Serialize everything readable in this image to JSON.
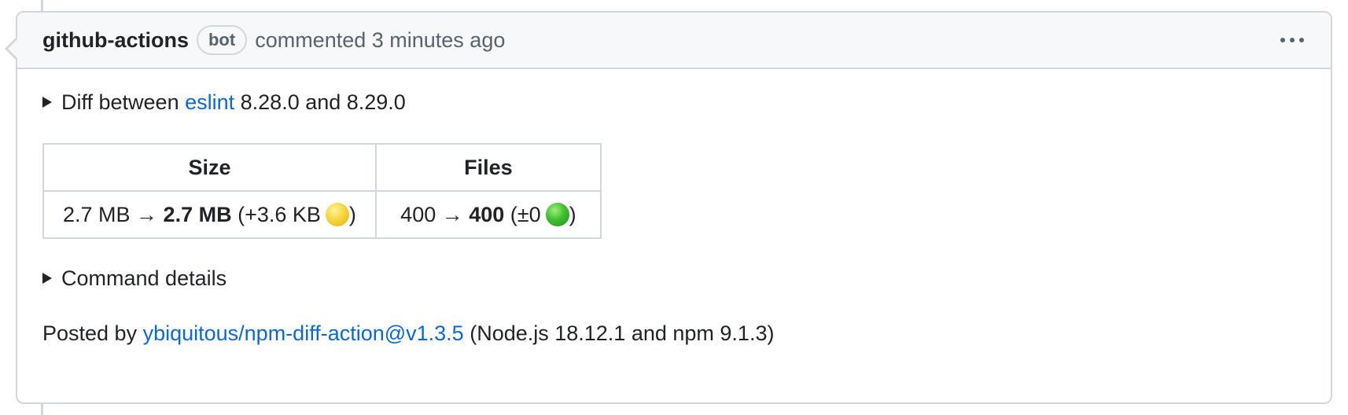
{
  "comment": {
    "author": "github-actions",
    "badge": "bot",
    "meta": "commented 3 minutes ago",
    "menu_icon": "kebab-horizontal-icon"
  },
  "diff_summary": {
    "prefix": "Diff between ",
    "package_link": "eslint",
    "versions": " 8.28.0 and 8.29.0"
  },
  "table": {
    "headers": [
      "Size",
      "Files"
    ],
    "size": {
      "from": "2.7 MB → ",
      "to": "2.7 MB",
      "delta_open": " (+3.6 KB",
      "close": ")",
      "indicator": "yellow-circle-icon",
      "indicator_color": "#f6d53b"
    },
    "files": {
      "from": "400 → ",
      "to": "400",
      "delta_open": " (±0",
      "close": ")",
      "indicator": "green-circle-icon",
      "indicator_color": "#3fbf30"
    }
  },
  "command_details": {
    "label": "Command details"
  },
  "footer": {
    "prefix": "Posted by ",
    "link": "ybiquitous/npm-diff-action@v1.3.5",
    "suffix": " (Node.js 18.12.1 and npm 9.1.3)"
  },
  "colors": {
    "link": "#0969da",
    "border": "#d0d7de",
    "header_bg": "#f6f8fa",
    "muted": "#59636e"
  }
}
